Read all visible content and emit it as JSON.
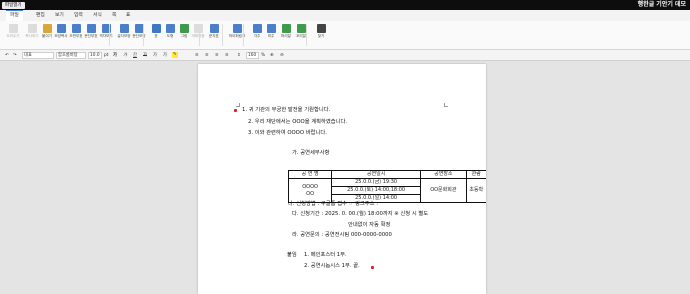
{
  "window": {
    "badge": "파일열기",
    "title": "행한글 기안기 데모"
  },
  "menu": [
    {
      "label": "파일",
      "active": true
    },
    {
      "label": "편집"
    },
    {
      "label": "보기"
    },
    {
      "label": "입력"
    },
    {
      "label": "서식"
    },
    {
      "label": "쪽"
    },
    {
      "label": "표"
    }
  ],
  "ribbon": [
    {
      "label": "오려두기",
      "icon": "cut-icon",
      "color": "#b0b0b0",
      "disabled": true
    },
    {
      "label": "복사하기",
      "icon": "copy-icon",
      "color": "#b0b0b0",
      "disabled": true
    },
    {
      "label": "붙이기",
      "icon": "paste-icon",
      "color": "#d9a63a"
    },
    {
      "label": "모양복사",
      "icon": "format-painter-icon",
      "color": "#4a7fc9"
    },
    {
      "label": "조판부호",
      "icon": "control-code-icon",
      "color": "#4a7fc9"
    },
    {
      "label": "문단부호",
      "icon": "paragraph-mark-icon",
      "color": "#4a7fc9"
    },
    {
      "label": "격자보기",
      "icon": "grid-icon",
      "color": "#4a7fc9"
    },
    {
      "label": "글자모양",
      "icon": "char-shape-icon",
      "color": "#4a7fc9"
    },
    {
      "label": "문단모양",
      "icon": "para-shape-icon",
      "color": "#4a7fc9"
    },
    {
      "label": "표",
      "icon": "table-icon",
      "color": "#3d78c4"
    },
    {
      "label": "도형",
      "icon": "shape-icon",
      "color": "#4a7fc9"
    },
    {
      "label": "그림",
      "icon": "image-icon",
      "color": "#3f9a4a"
    },
    {
      "label": "개체묶음",
      "icon": "group-icon",
      "color": "#b0b0b0",
      "disabled": true
    },
    {
      "label": "문자표",
      "icon": "symbol-icon",
      "color": "#4a7fc9"
    },
    {
      "label": "하이퍼링크",
      "icon": "hyperlink-icon",
      "color": "#4a7fc9"
    },
    {
      "label": "각주",
      "icon": "footnote-icon",
      "color": "#4a7fc9"
    },
    {
      "label": "미주",
      "icon": "endnote-icon",
      "color": "#4a7fc9"
    },
    {
      "label": "머리말",
      "icon": "header-icon",
      "color": "#3f9a4a"
    },
    {
      "label": "꼬리말",
      "icon": "footer-icon",
      "color": "#3f9a4a"
    },
    {
      "label": "찾기",
      "icon": "find-icon",
      "color": "#444444"
    }
  ],
  "format": {
    "style": "대표",
    "font": "함초롬바탕",
    "size": "10.0",
    "unit": "pt",
    "bold": "가",
    "italic": "가",
    "underline": "간",
    "strike": "가",
    "super": "가",
    "zoom": "160",
    "zoom_unit": "%"
  },
  "doc": {
    "lines_top": [
      "1.  귀 기관의 무궁한 발전을 기원합니다.",
      "2.  우리 재단에서는 OOO을 계획하였습니다.",
      "3.  이와 관련하여 OOOO 바랍니다."
    ],
    "section_title": "가. 공연세부사항",
    "table": {
      "headers": [
        "공 연 명",
        "공연일시",
        "공연장소",
        "관람"
      ],
      "name": "OOOO\nOO",
      "dates": [
        "25.0.0.(금) 19:30",
        "25.0.0.(토) 14:00,18:00",
        "25.0.0.(일) 14:00"
      ],
      "venue": "OO문화회관",
      "audience": "초등학"
    },
    "lines_mid": [
      "나. 신청방법 : 구글폼 접수 ☞ 링크주소 :",
      "다. 신청기간 : 2025. 0. 00.(월) 18:00까지 ※ 신청 시 별도",
      "안내없이 자동 확정",
      "라. 공연문의 : 공연전시팀 000-0000-0000"
    ],
    "attach_label": "붙임",
    "attachments": [
      "1.  메인포스터 1부.",
      "2.  공연시놉시스 1부.  끝."
    ]
  }
}
